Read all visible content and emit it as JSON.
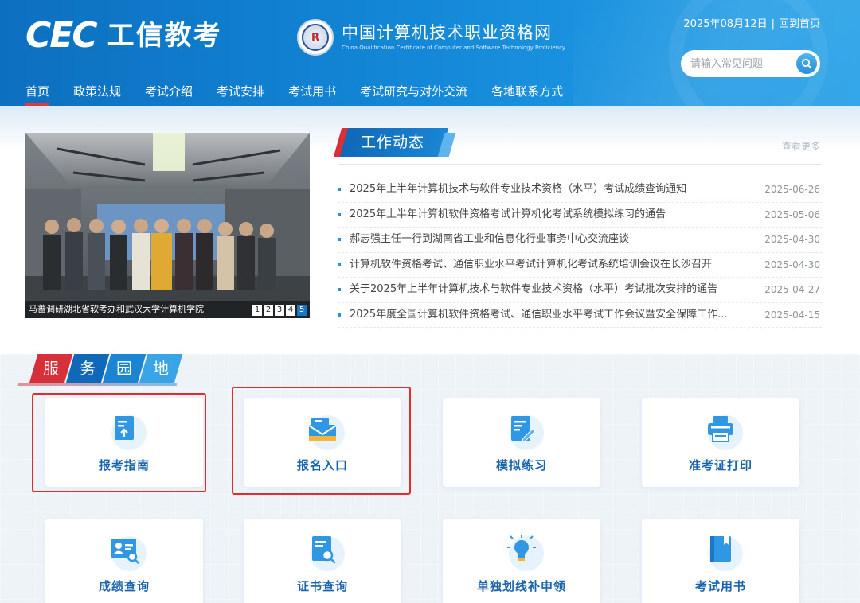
{
  "header": {
    "logo_text": "CEC",
    "brand_cn": "工信教考",
    "emblem_text": "R",
    "site_name": "中国计算机技术职业资格网",
    "site_subtitle": "China Qualification Certificate of Computer and Software Technology Proficiency",
    "date": "2025年08月12日",
    "date_separator": "|",
    "home_link": "回到首页",
    "search": {
      "placeholder": "请输入常见问题"
    },
    "nav": [
      "首页",
      "政策法规",
      "考试介绍",
      "考试安排",
      "考试用书",
      "考试研究与对外交流",
      "各地联系方式"
    ]
  },
  "slider": {
    "caption": "马蔷调研湖北省软考办和武汉大学计算机学院",
    "pages": [
      "1",
      "2",
      "3",
      "4",
      "5"
    ],
    "active_page": "5"
  },
  "news": {
    "title": "工作动态",
    "more": "查看更多",
    "items": [
      {
        "title": "2025年上半年计算机技术与软件专业技术资格（水平）考试成绩查询通知",
        "date": "2025-06-26"
      },
      {
        "title": "2025年上半年计算机软件资格考试计算机化考试系统模拟练习的通告",
        "date": "2025-05-06"
      },
      {
        "title": "郝志强主任一行到湖南省工业和信息化行业事务中心交流座谈",
        "date": "2025-04-30"
      },
      {
        "title": "计算机软件资格考试、通信职业水平考试计算机化考试系统培训会议在长沙召开",
        "date": "2025-04-30"
      },
      {
        "title": "关于2025年上半年计算机技术与软件专业技术资格（水平）考试批次安排的通告",
        "date": "2025-04-27"
      },
      {
        "title": "2025年度全国计算机软件资格考试、通信职业水平考试工作会议暨安全保障工作...",
        "date": "2025-04-15"
      }
    ]
  },
  "service": {
    "title_chars": [
      "服",
      "务",
      "园",
      "地"
    ],
    "cards": [
      {
        "label": "报考指南",
        "icon": "document-upload-icon"
      },
      {
        "label": "报名入口",
        "icon": "mail-envelope-icon"
      },
      {
        "label": "模拟练习",
        "icon": "edit-document-icon"
      },
      {
        "label": "准考证打印",
        "icon": "printer-icon"
      },
      {
        "label": "成绩查询",
        "icon": "id-card-search-icon"
      },
      {
        "label": "证书查询",
        "icon": "certificate-search-icon"
      },
      {
        "label": "单独划线补申领",
        "icon": "lightbulb-icon"
      },
      {
        "label": "考试用书",
        "icon": "book-icon"
      }
    ]
  },
  "colors": {
    "header_blue": "#1386d6",
    "accent_red": "#d6303a",
    "card_label": "#1a64ac",
    "highlight_red": "#e42b2b"
  }
}
